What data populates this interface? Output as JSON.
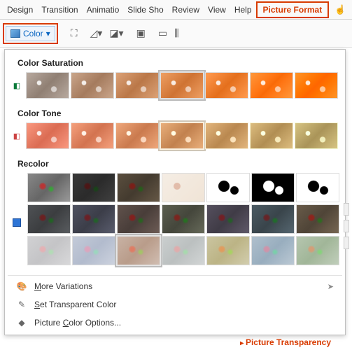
{
  "ribbon": {
    "tabs": [
      "Design",
      "Transition",
      "Animatio",
      "Slide Sho",
      "Review",
      "View",
      "Help",
      "Picture Format"
    ],
    "highlighted_index": 7
  },
  "toolbar": {
    "color_button": "Color"
  },
  "panel": {
    "sections": {
      "saturation": {
        "label": "Color Saturation",
        "count": 7,
        "selected_index": 3
      },
      "tone": {
        "label": "Color Tone",
        "count": 7,
        "selected_index": 3
      },
      "recolor": {
        "label": "Recolor"
      }
    },
    "recolor_row1": [
      {
        "name": "no-recolor",
        "ov": ""
      },
      {
        "name": "grayscale",
        "ov": "rgba(80,80,80,0.85)"
      },
      {
        "name": "sepia",
        "ov": "rgba(140,110,70,0.75)"
      },
      {
        "name": "washout",
        "ov": "washout"
      },
      {
        "name": "black-white-25",
        "ov": "bwneg"
      },
      {
        "name": "black-white-50",
        "ov": "bwpos"
      },
      {
        "name": "black-white-75",
        "ov": "bwneg"
      }
    ],
    "recolor_row2_ov": [
      "rgba(60,70,80,0.55)",
      "rgba(60,70,120,0.55)",
      "rgba(120,70,50,0.55)",
      "rgba(100,110,60,0.55)",
      "rgba(80,60,110,0.55)",
      "rgba(50,100,130,0.55)",
      "rgba(150,100,40,0.55)"
    ],
    "recolor_row3": [
      {
        "ov": "rgba(210,210,215,0.75)",
        "sel": false
      },
      {
        "ov": "rgba(170,190,230,0.75)",
        "sel": false
      },
      {
        "ov": "rgba(230,150,100,0.6)",
        "sel": true
      },
      {
        "ov": "rgba(190,200,200,0.75)",
        "sel": false
      },
      {
        "ov": "rgba(220,200,80,0.65)",
        "sel": false
      },
      {
        "ov": "rgba(120,170,210,0.7)",
        "sel": false
      },
      {
        "ov": "rgba(140,190,120,0.7)",
        "sel": false
      }
    ],
    "menu": {
      "more_variations": "More Variations",
      "set_transparent": "Set Transparent Color",
      "picture_color_options": "Picture Color Options..."
    }
  },
  "peeker": "Picture Transparency"
}
